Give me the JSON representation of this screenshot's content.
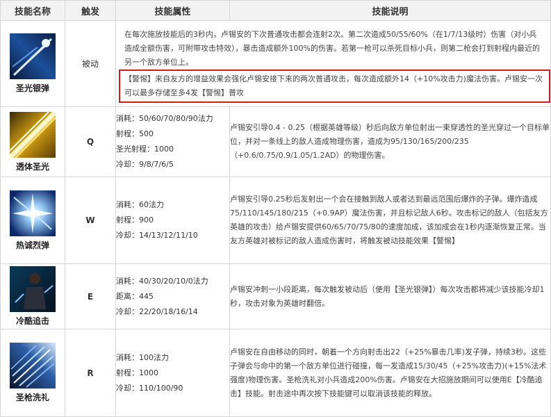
{
  "headers": {
    "name": "技能名称",
    "trigger": "触发",
    "attributes": "技能属性",
    "description": "技能说明"
  },
  "skills": [
    {
      "name": "圣光银弹",
      "trigger": "被动",
      "attributes": [],
      "description": "在每次施放技能后的3秒内，卢锡安的下次普通攻击都会连射2次。第二次造成50/55/60%（在1/7/13级时）伤害（对小兵造成全额伤害，可附带攻击特效），暴击造成额外100%的伤害。若第一枪可以杀死目标小兵，则第二枪会打到射程内最近的另一个敌方单位上。",
      "highlight": "【警惕】来自友方的增益效果会强化卢锡安接下来的两次普通攻击，每次造成额外14（+10%攻击力)魔法伤害。卢锡安一次可以最多存储至多4发【警惕】普攻"
    },
    {
      "name": "透体圣光",
      "trigger": "Q",
      "attributes": [
        "消耗：50/60/70/80/90法力",
        "射程：500",
        "圣光射程：1000",
        "冷却：9/8/7/6/5"
      ],
      "description": "卢锡安引导0.4 - 0.25（根据英雄等级）秒后向敌方单位射出一束穿透性的圣光穿过一个目标单位，并对一条线上的敌人造成物理伤害，造成为95/130/165/200/235（+0.6/0.75/0.9/1.05/1.2AD）的物理伤害。"
    },
    {
      "name": "热诚烈弹",
      "trigger": "W",
      "attributes": [
        "消耗：60法力",
        "射程：900",
        "冷却：14/13/12/11/10"
      ],
      "description": "卢锡安引导0.25秒后发射出一个会在接触到敌人或者达到最远范围后爆炸的子弹。爆炸造成75/110/145/180/215（+0.9AP）魔法伤害，并且标记敌人6秒。攻击标记的敌人（包括友方英雄的攻击）给卢锡安提供60/65/70/75/80的速度加成，该加成会在1秒内逐渐恢复正常。当友方英雄对被标记的敌人造成伤害时，将触发被动技能效果【警惕】"
    },
    {
      "name": "冷酷追击",
      "trigger": "E",
      "attributes": [
        "消耗：40/30/20/10/0法力",
        "距离：445",
        "冷却：22/20/18/16/14"
      ],
      "description": "卢锡安冲刺一小段距离，每次触发被动后（使用【圣光银弹】）每次攻击都将减少该技能冷却1秒，攻击对象为英雄时翻倍。"
    },
    {
      "name": "圣枪洗礼",
      "trigger": "R",
      "attributes": [
        "消耗：100法力",
        "射程：1000",
        "冷却：110/100/90"
      ],
      "description": "卢锡安在自由移动的同时，朝着一个方向射击出22（+25%暴击几率)发子弹，持续3秒。这些子弹会与命中的第一个敌方单位进行碰撞，每一发造成15/30/45（+25%攻击力)(+15%法术强度)物理伤害。圣枪洗礼对小兵造成200%伤害。卢锡安在大招施放期间可以使用E【冷酷追击】技能。射击途中再次按下技能键可以取消该技能的释放。"
    }
  ],
  "colors": {
    "highlight_border": "#c81f1f",
    "header_bg": "#f2f2f2",
    "grid": "#d6d6d6"
  },
  "icons": [
    "silver-bullet-icon",
    "piercing-light-icon",
    "ardent-blaze-icon",
    "relentless-pursuit-icon",
    "the-culling-icon"
  ]
}
